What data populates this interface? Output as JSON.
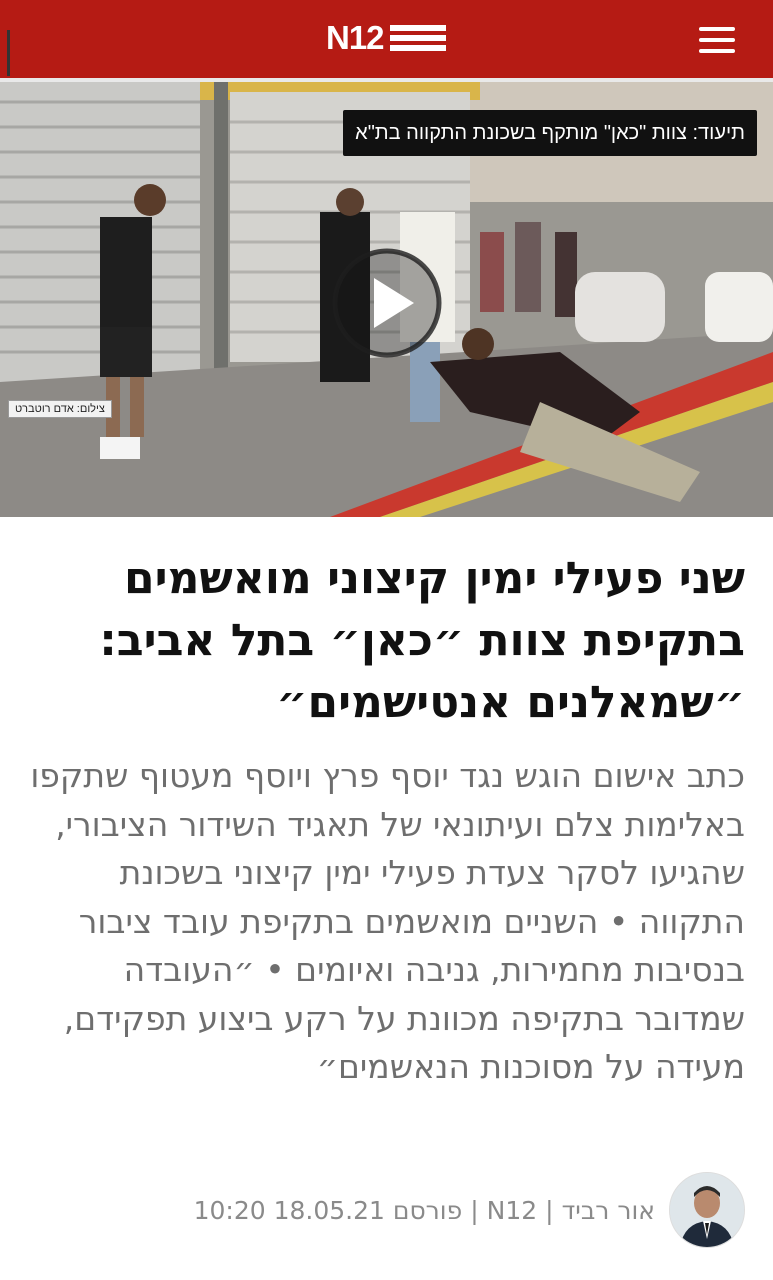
{
  "header": {
    "logo_text": "N12",
    "brand_color": "#b51b14",
    "menu_icon": "hamburger-menu-icon"
  },
  "video": {
    "caption": "תיעוד: צוות \"כאן\" מותקף בשכונת התקווה בת\"א",
    "credit": "צילום: אדם רוטברט",
    "play_icon": "play-icon"
  },
  "article": {
    "headline": "שני פעילי ימין קיצוני מואשמים בתקיפת צוות ״כאן״ בתל אביב: ״שמאלנים אנטישמים״",
    "summary": "כתב אישום הוגש נגד יוסף פרץ ויוסף מעטוף שתקפו באלימות צלם ועיתונאי של תאגיד השידור הציבורי, שהגיעו לסקר צעדת פעילי ימין קיצוני בשכונת התקווה • השניים מואשמים בתקיפת עובד ציבור בנסיבות מחמירות, גניבה ואיומים • ״העובדה שמדובר בתקיפה מכוונת על רקע ביצוע תפקידם, מעידה על מסוכנות הנאשמים״"
  },
  "byline": {
    "author": "אור רביד",
    "source": "N12",
    "published_label": "פורסם",
    "date": "18.05.21",
    "time": "10:20",
    "separator": "|"
  }
}
